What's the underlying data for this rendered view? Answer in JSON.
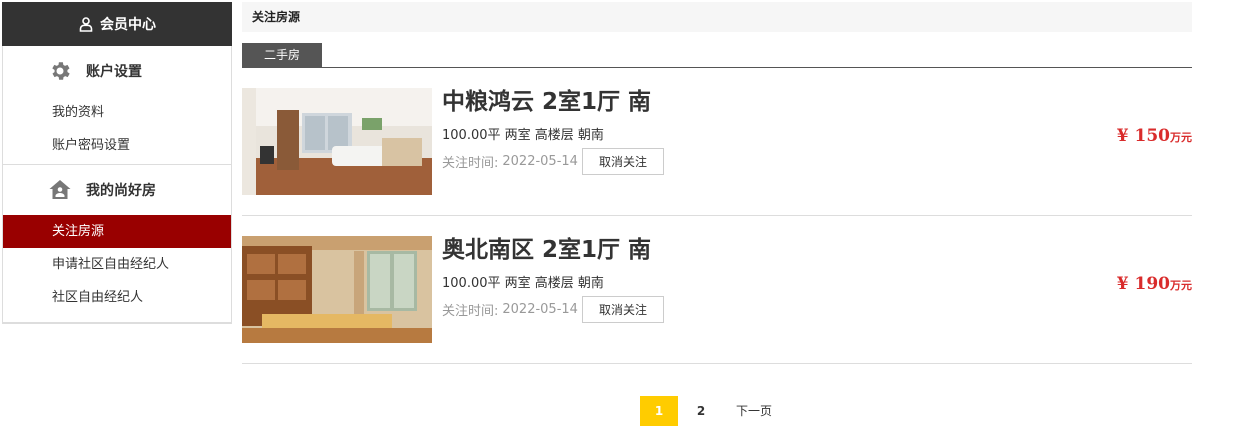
{
  "sidebar": {
    "header": "会员中心",
    "groups": [
      {
        "title": "账户设置",
        "icon": "gear-icon",
        "items": [
          "我的资料",
          "账户密码设置"
        ]
      },
      {
        "title": "我的尚好房",
        "icon": "house-icon",
        "items": [
          "关注房源",
          "申请社区自由经纪人",
          "社区自由经纪人"
        ]
      }
    ],
    "active_item": "关注房源"
  },
  "main": {
    "title": "关注房源",
    "tabs": [
      "二手房"
    ],
    "listings": [
      {
        "name": "中粮鸿云 2室1厅 南",
        "specs": "100.00平 两室 高楼层 朝南",
        "follow_label": "关注时间:",
        "follow_date": "2022-05-14",
        "unfollow": "取消关注",
        "price_prefix": "¥",
        "price": "150",
        "price_unit": "万元"
      },
      {
        "name": "奥北南区 2室1厅 南",
        "specs": "100.00平 两室 高楼层 朝南",
        "follow_label": "关注时间:",
        "follow_date": "2022-05-14",
        "unfollow": "取消关注",
        "price_prefix": "¥",
        "price": "190",
        "price_unit": "万元"
      }
    ],
    "pagination": {
      "pages": [
        "1",
        "2"
      ],
      "current": "1",
      "next": "下一页"
    }
  },
  "colors": {
    "active_bg": "#990000",
    "price": "#d92b2b",
    "current_page": "#ffcc00",
    "header_bg": "#333333"
  }
}
